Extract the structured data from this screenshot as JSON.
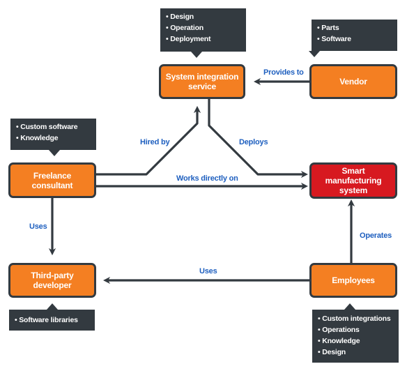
{
  "diagram": {
    "colors": {
      "node_fill": "#f47f22",
      "node_highlight_fill": "#d71920",
      "node_border": "#333a40",
      "tooltip_bg": "#333a40",
      "edge_label": "#1e5fbf"
    },
    "nodes": {
      "system_integration": {
        "label": "System integration service",
        "details": [
          "Design",
          "Operation",
          "Deployment"
        ]
      },
      "vendor": {
        "label": "Vendor",
        "details": [
          "Parts",
          "Software"
        ]
      },
      "freelance": {
        "label": "Freelance consultant",
        "details": [
          "Custom software",
          "Knowledge"
        ]
      },
      "smart": {
        "label": "Smart manufacturing system",
        "details": []
      },
      "third_party": {
        "label": "Third-party developer",
        "details": [
          "Software libraries"
        ]
      },
      "employees": {
        "label": "Employees",
        "details": [
          "Custom integrations",
          "Operations",
          "Knowledge",
          "Design"
        ]
      }
    },
    "edges": {
      "provides_to": {
        "from": "Vendor",
        "to": "System integration service",
        "label": "Provides to"
      },
      "hired_by": {
        "from": "Freelance consultant",
        "to": "System integration service",
        "label": "Hired by"
      },
      "deploys": {
        "from": "System integration service",
        "to": "Smart manufacturing system",
        "label": "Deploys"
      },
      "works_directly_on": {
        "from": "Freelance consultant",
        "to": "Smart manufacturing system",
        "label": "Works directly on"
      },
      "uses_freelance": {
        "from": "Freelance consultant",
        "to": "Third-party developer",
        "label": "Uses"
      },
      "uses_employees": {
        "from": "Employees",
        "to": "Third-party developer",
        "label": "Uses"
      },
      "operates": {
        "from": "Employees",
        "to": "Smart manufacturing system",
        "label": "Operates"
      }
    }
  }
}
